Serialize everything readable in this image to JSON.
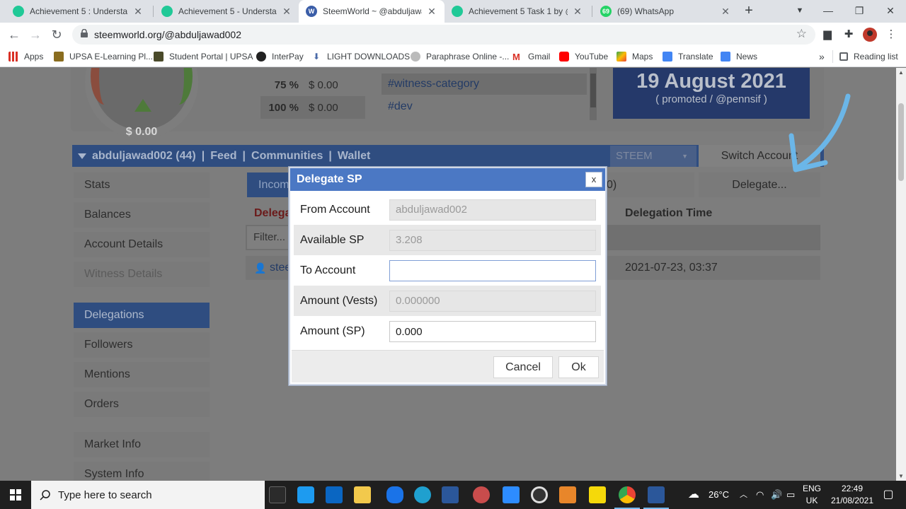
{
  "browser": {
    "tabs": [
      {
        "title": "Achievement 5 : Understandir",
        "favicon_color": "#20c997"
      },
      {
        "title": "Achievement 5 - Understandi",
        "favicon_color": "#20c997"
      },
      {
        "title": "SteemWorld ~ @abduljawadi",
        "favicon_color": "#3b5ea8"
      },
      {
        "title": "Achievement 5 Task 1 by @ar",
        "favicon_color": "#20c997"
      },
      {
        "title": "(69) WhatsApp",
        "favicon_color": "#25d366",
        "badge": "69"
      }
    ],
    "url": "steemworld.org/@abduljawad002",
    "bookmarks": [
      {
        "label": "Apps",
        "color": "#5f6368"
      },
      {
        "label": "UPSA E-Learning Pl...",
        "color": "#8a6d1f"
      },
      {
        "label": "Student Portal | UPSA",
        "color": "#4a4a2a"
      },
      {
        "label": "InterPay",
        "color": "#222222"
      },
      {
        "label": "LIGHT DOWNLOADS",
        "color": "#4a6aa8"
      },
      {
        "label": "Paraphrase Online -...",
        "color": "#777777"
      },
      {
        "label": "Gmail",
        "color": "#d93025"
      },
      {
        "label": "YouTube",
        "color": "#ff0000"
      },
      {
        "label": "Maps",
        "color": "#34a853"
      },
      {
        "label": "Translate",
        "color": "#4285f4"
      },
      {
        "label": "News",
        "color": "#4285f4"
      }
    ],
    "reading_list": "Reading list",
    "more_bookmarks": "»"
  },
  "page": {
    "gauge_value": "$ 0.00",
    "vote_values": [
      {
        "pct": "75 %",
        "amount": "$ 0.00"
      },
      {
        "pct": "100 %",
        "amount": "$ 0.00"
      }
    ],
    "tags": [
      "#witness-category",
      "#dev"
    ],
    "promo": {
      "date": "19 August 2021",
      "by": "( promoted / @pennsif )"
    },
    "account_bar": {
      "account": "abduljawad002 (44)",
      "sep": "|",
      "links": [
        "Feed",
        "Communities",
        "Wallet"
      ]
    },
    "chain_select": "STEEM",
    "switch_account": "Switch Account",
    "sidebar": [
      "Stats",
      "Balances",
      "Account Details",
      "Witness Details",
      "Delegations",
      "Followers",
      "Mentions",
      "Orders",
      "Market Info",
      "System Info"
    ],
    "subtab_incoming": "Incom",
    "subtab_mid": "0)",
    "delegate_button": "Delegate...",
    "table": {
      "col_delegator": "Delega",
      "col_time": "Delegation Time",
      "filter": "Filter...",
      "row_account": "stee",
      "row_time": "2021-07-23, 03:37"
    }
  },
  "modal": {
    "title": "Delegate SP",
    "close": "x",
    "fields": [
      {
        "label": "From Account",
        "value": "abduljawad002",
        "readonly": true
      },
      {
        "label": "Available SP",
        "value": "3.208",
        "readonly": true
      },
      {
        "label": "To Account",
        "value": "",
        "readonly": false
      },
      {
        "label": "Amount (Vests)",
        "value": "0.000000",
        "readonly": true
      },
      {
        "label": "Amount (SP)",
        "value": "0.000",
        "readonly": false
      }
    ],
    "cancel": "Cancel",
    "ok": "Ok"
  },
  "taskbar": {
    "search_placeholder": "Type here to search",
    "weather": "26°C",
    "lang_line1": "ENG",
    "lang_line2": "UK",
    "time": "22:49",
    "date": "21/08/2021"
  },
  "colors": {
    "modal_header": "#4b78c4",
    "annotation_arrow": "#6bb6e8"
  }
}
